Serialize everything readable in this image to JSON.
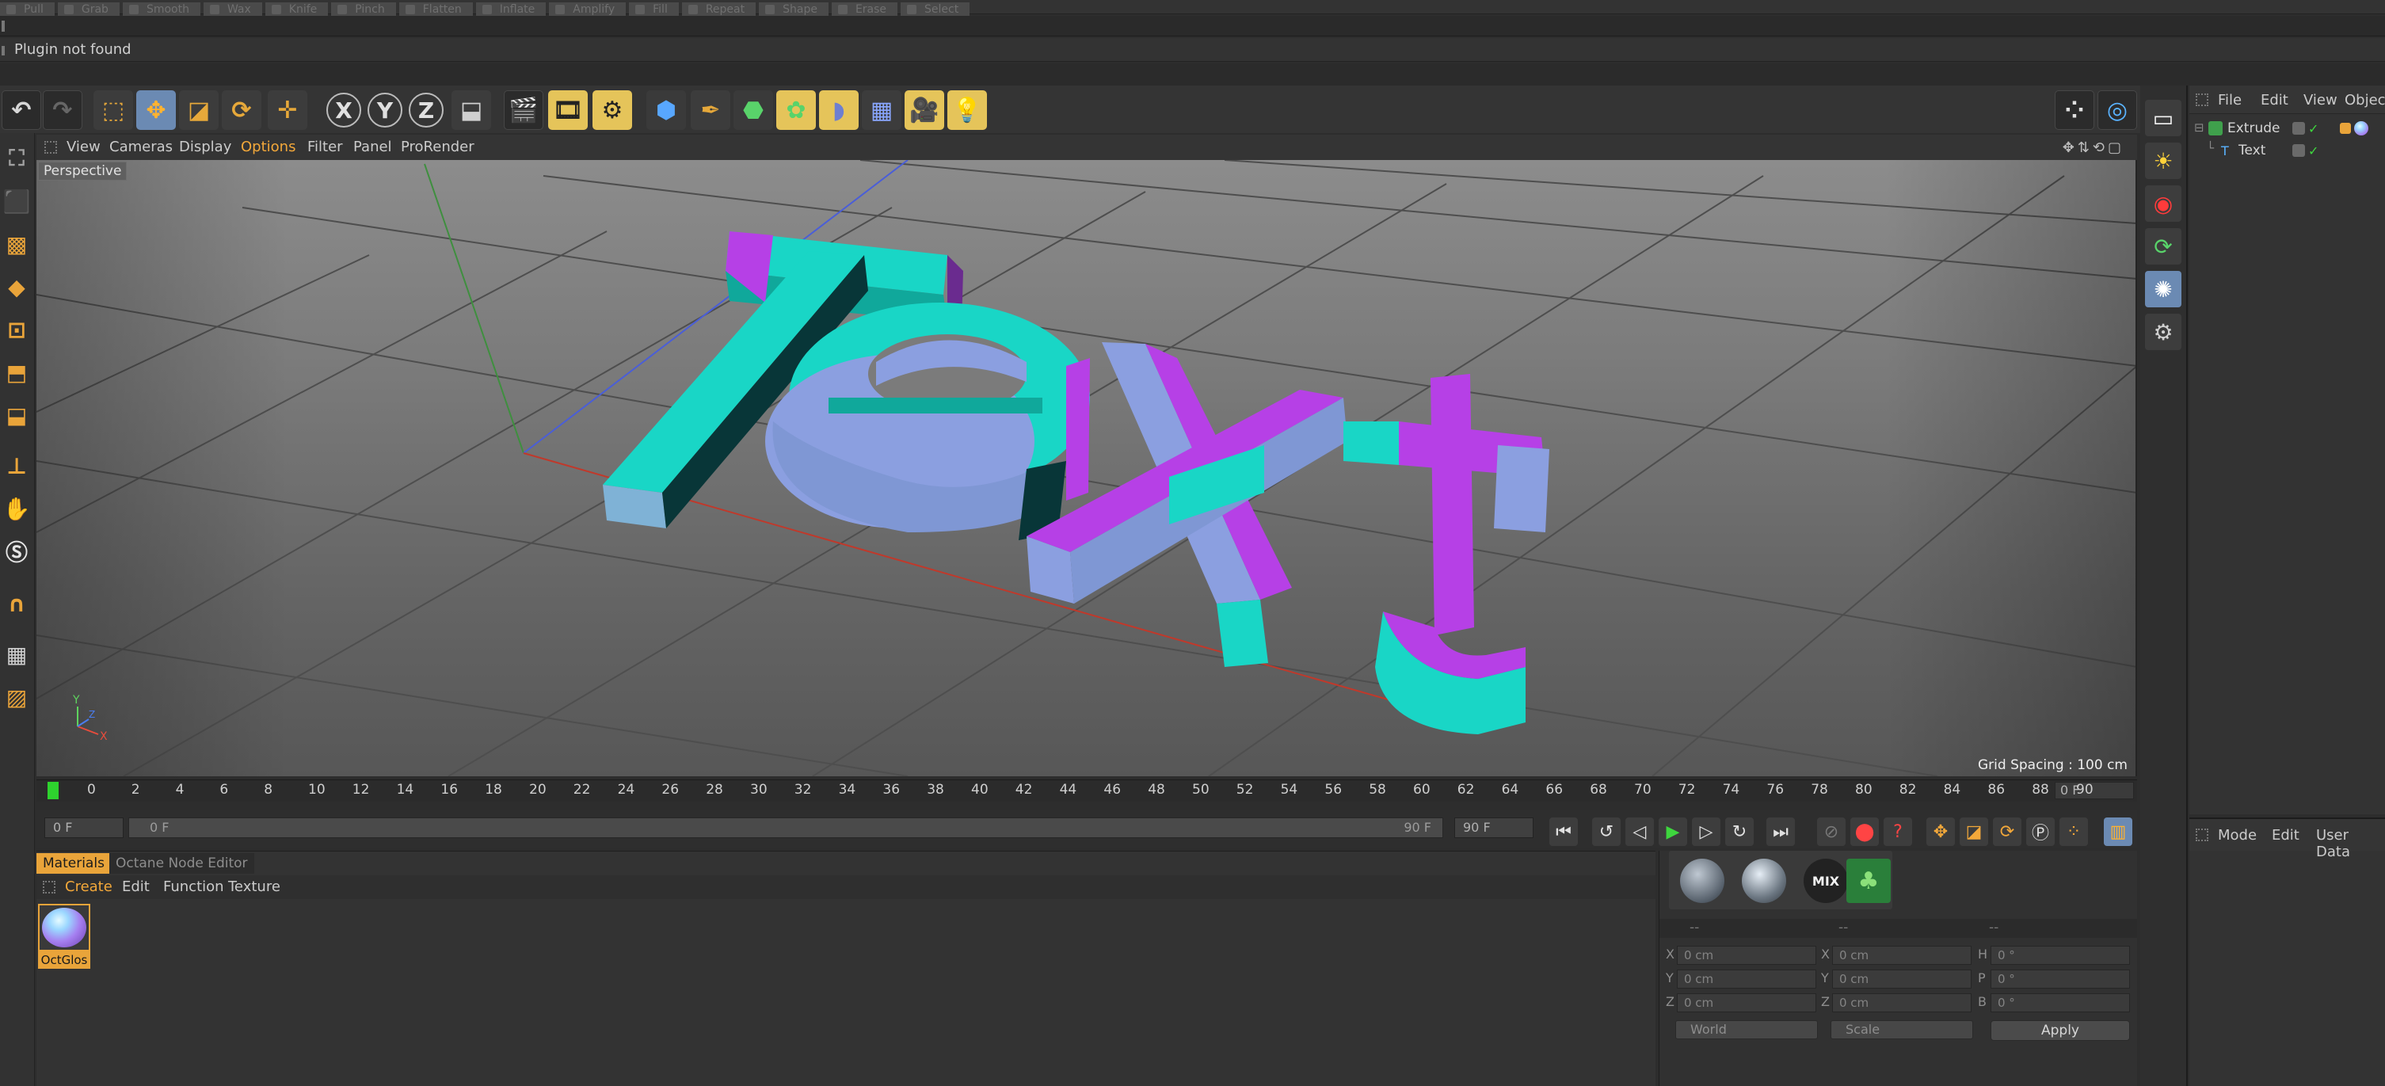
{
  "top_menu": [
    "Pull",
    "Grab",
    "Smooth",
    "Wax",
    "Knife",
    "Pinch",
    "Flatten",
    "Inflate",
    "Amplify",
    "Fill",
    "Repeat",
    "Shape",
    "Erase",
    "Select"
  ],
  "status_text": "Plugin not found",
  "viewport_menu": {
    "items": [
      "View",
      "Cameras",
      "Display",
      "Options",
      "Filter",
      "Panel",
      "ProRender"
    ],
    "highlighted": "Options",
    "camera_label": "Perspective",
    "grid_spacing": "Grid Spacing : 100 cm"
  },
  "scene_text": "Text",
  "axis_labels": {
    "x": "X",
    "y": "Y",
    "z": "Z"
  },
  "timeline": {
    "ticks": [
      "0",
      "2",
      "4",
      "6",
      "8",
      "10",
      "12",
      "14",
      "16",
      "18",
      "20",
      "22",
      "24",
      "26",
      "28",
      "30",
      "32",
      "34",
      "36",
      "38",
      "40",
      "42",
      "44",
      "46",
      "48",
      "50",
      "52",
      "54",
      "56",
      "58",
      "60",
      "62",
      "64",
      "66",
      "68",
      "70",
      "72",
      "74",
      "76",
      "78",
      "80",
      "82",
      "84",
      "86",
      "88",
      "90"
    ],
    "current_frame": "0 F"
  },
  "transport": {
    "start_field": "0 F",
    "range_start": "0 F",
    "range_end": "90 F",
    "end_field": "90 F"
  },
  "materials": {
    "tabs": [
      "Materials",
      "Octane Node Editor"
    ],
    "menu": [
      "Create",
      "Edit",
      "Function",
      "Texture"
    ],
    "items": [
      {
        "name": "OctGlos"
      }
    ]
  },
  "coords": {
    "headers": [
      "--",
      "--",
      "--"
    ],
    "rows": [
      {
        "a": "X",
        "pos": "0 cm",
        "b": "X",
        "size": "0 cm",
        "c": "H",
        "rot": "0 °"
      },
      {
        "a": "Y",
        "pos": "0 cm",
        "b": "Y",
        "size": "0 cm",
        "c": "P",
        "rot": "0 °"
      },
      {
        "a": "Z",
        "pos": "0 cm",
        "b": "Z",
        "size": "0 cm",
        "c": "B",
        "rot": "0 °"
      }
    ],
    "space": "World",
    "mode": "Scale",
    "apply": "Apply",
    "octane_mix": "MIX"
  },
  "object_manager": {
    "menu": [
      "File",
      "Edit",
      "View",
      "Object"
    ],
    "objects": [
      {
        "name": "Extrude",
        "depth": 0
      },
      {
        "name": "Text",
        "depth": 1
      }
    ]
  },
  "attribute_manager": {
    "menu": [
      "Mode",
      "Edit",
      "User Data"
    ]
  },
  "toolbar_axes": [
    "X",
    "Y",
    "Z"
  ],
  "colors": {
    "accent": "#e9a43a",
    "cyan_face": "#19d6c6",
    "magenta_face": "#b640e6",
    "lavender_face": "#8b9fe0",
    "viewport_bg": "#7a7a7a"
  }
}
